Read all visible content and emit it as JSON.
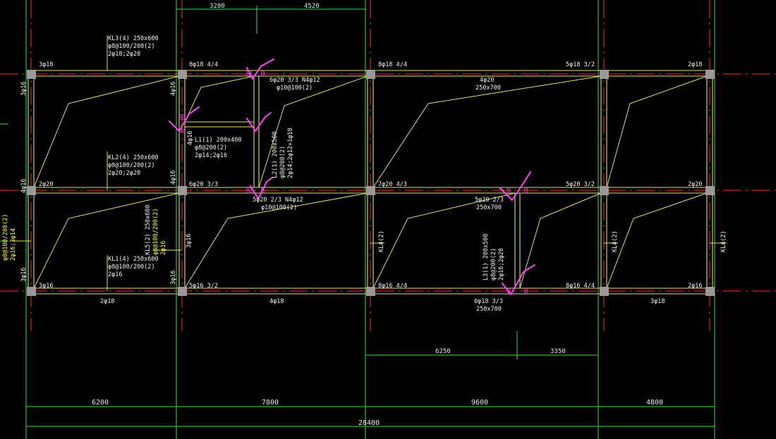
{
  "colors": {
    "background": "#000000",
    "beam": "#e0e060",
    "axis": "#ff2a2a",
    "dimension": "#30e030",
    "column": "#9a9a9a",
    "check_mark": "#ff40ff",
    "text": "#f2f2f2",
    "highlight_text": "#ffff33"
  },
  "top_dimensions": [
    "3280",
    "4520"
  ],
  "bottom_dimensions": {
    "sub": [
      "6250",
      "3350"
    ],
    "bays": [
      "6200",
      "7800",
      "9600",
      "4800"
    ],
    "total": "28400"
  },
  "annotations": {
    "kl3_line1": "KL3(4) 250x600",
    "kl3_line2": "φ8@100/200(2)",
    "kl3_line3": "2φ18;2φ20",
    "kl2_line1": "KL2(4) 250x600",
    "kl2_line2": "φ8@100/200(2)",
    "kl2_line3": "2φ20;2φ20",
    "kl1_line1": "KL1(4) 250x600",
    "kl1_line2": "φ8@100/200(2)",
    "kl1_line3": "2φ16",
    "l1_line1": "L1(1) 200x400",
    "l1_line2": "φ8@200(2)",
    "l1_line3": "2φ14;2φ16",
    "l2_line1": "L2(1) 200x500",
    "l2_line2": "φ8@200(2)",
    "l2_line3": "2φ14;2φ12+1φ18",
    "l3_line1": "L3(1) 200x500",
    "l3_line2": "φ8@200(2)",
    "l3_line3": "2φ16;2φ20",
    "kl5_line1": "KL5(2) 250x600",
    "kl5_line2": "φ8@100/200(2)",
    "kl5_line3": "2φ16",
    "left_yellow_1": "φ8@100/200(2)",
    "left_yellow_2": "2φ16;3φ14",
    "beam_250x700_a": "250x700",
    "beam_250x700_b": "250x700",
    "beam_250x700_c": "250x700",
    "kl4_a": "KL4(2)",
    "kl4_b": "KL4(2)",
    "kl4_c": "KL4(2)"
  },
  "rebar_labels": {
    "r1": "3φ18",
    "r2": "8φ18 4/4",
    "r3": "8φ18 4/4",
    "r4": "5φ18 3/2",
    "r5": "2φ18",
    "r6": "6φ20 3/3 N4φ12",
    "r7": "φ10@100(2)",
    "r8": "4φ20",
    "r9": "2φ20",
    "r10": "6φ20 3/3",
    "r11": "7φ20 4/3",
    "r12": "5φ20 3/2",
    "r13": "2φ20",
    "r14": "5φ20 2/3 N4φ12",
    "r15": "φ10@100(2)",
    "r16": "5φ20 2/3",
    "r17": "3φ16",
    "r18": "5φ16 3/2",
    "r19": "8φ16 4/4",
    "r20": "8φ16 4/4",
    "r21": "2φ16",
    "r22": "2φ18",
    "r23": "4φ18",
    "r24": "6φ18 3/3",
    "r25": "3φ18",
    "r26": "3φ16",
    "r27": "4φ16",
    "r28": "3φ16",
    "r29": "4φ16",
    "r30": "4φ16",
    "r31": "4φ16",
    "r32": "3φ16",
    "r33": "3φ16"
  }
}
